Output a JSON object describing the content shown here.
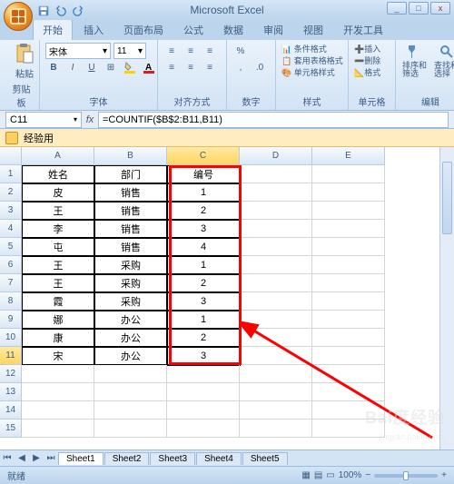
{
  "app": {
    "title": "Microsoft Excel"
  },
  "win": {
    "min": "_",
    "max": "□",
    "close": "x"
  },
  "tabs": [
    "开始",
    "插入",
    "页面布局",
    "公式",
    "数据",
    "审阅",
    "视图",
    "开发工具"
  ],
  "ribbon": {
    "paste": "粘贴",
    "clipboard": "剪贴板",
    "font_name": "宋体",
    "font_size": "11",
    "font_label": "字体",
    "align_label": "对齐方式",
    "number_label": "数字",
    "style_cond": "条件格式",
    "style_table": "套用表格格式",
    "style_cell": "单元格样式",
    "style_label": "样式",
    "ins": "插入",
    "del": "删除",
    "fmt": "格式",
    "cells_label": "单元格",
    "sort": "排序和\n筛选",
    "find": "查找和\n选择",
    "edit_label": "编辑"
  },
  "namebox": "C11",
  "formula": "=COUNTIF($B$2:B11,B11)",
  "security": "经验用",
  "columns": [
    "A",
    "B",
    "C",
    "D",
    "E"
  ],
  "rowcount": 15,
  "table": {
    "headers": [
      "姓名",
      "部门",
      "编号"
    ],
    "rows": [
      [
        "皮",
        "销售",
        "1"
      ],
      [
        "王",
        "销售",
        "2"
      ],
      [
        "李",
        "销售",
        "3"
      ],
      [
        "屯",
        "销售",
        "4"
      ],
      [
        "王",
        "采购",
        "1"
      ],
      [
        "王",
        "采购",
        "2"
      ],
      [
        "霞",
        "采购",
        "3"
      ],
      [
        "娜",
        "办公",
        "1"
      ],
      [
        "康",
        "办公",
        "2"
      ],
      [
        "宋",
        "办公",
        "3"
      ]
    ]
  },
  "sheets": [
    "Sheet1",
    "Sheet2",
    "Sheet3",
    "Sheet4",
    "Sheet5"
  ],
  "status": {
    "ready": "就绪",
    "rec": "",
    "zoom": "100%"
  },
  "watermark": {
    "logo": "Bai度经验",
    "url": "jingyan.baidu.com"
  },
  "chart_data": null
}
